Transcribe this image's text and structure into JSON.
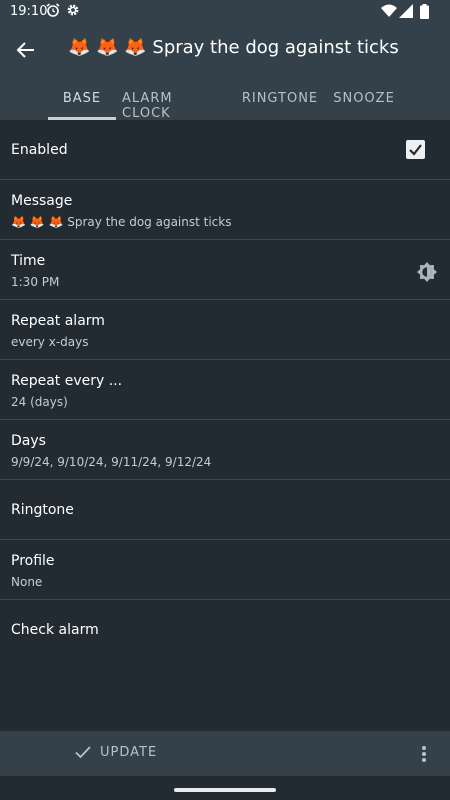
{
  "status_bar": {
    "time": "19:10",
    "icons": [
      "alarm-icon",
      "settings-icon",
      "wifi-icon",
      "signal-icon",
      "battery-icon"
    ]
  },
  "app_bar": {
    "back_icon": "arrow-back-icon",
    "title": "🦊 🦊 🦊 Spray the dog against ticks"
  },
  "tabs": [
    {
      "label": "BASE",
      "active": true
    },
    {
      "label": "ALARM CLOCK",
      "active": false
    },
    {
      "label": "RINGTONE",
      "active": false
    },
    {
      "label": "SNOOZE",
      "active": false
    }
  ],
  "settings": {
    "enabled": {
      "title": "Enabled",
      "checked": true
    },
    "message": {
      "title": "Message",
      "value": "🦊 🦊 🦊 Spray the dog against ticks"
    },
    "time": {
      "title": "Time",
      "value": "1:30 PM",
      "icon": "brightness-icon"
    },
    "repeat_alarm": {
      "title": "Repeat alarm",
      "value": "every x-days"
    },
    "repeat_every": {
      "title": "Repeat every ...",
      "value": "24 (days)"
    },
    "days": {
      "title": "Days",
      "value": "9/9/24, 9/10/24, 9/11/24, 9/12/24"
    },
    "ringtone": {
      "title": "Ringtone"
    },
    "profile": {
      "title": "Profile",
      "value": "None"
    },
    "check_alarm": {
      "title": "Check alarm"
    }
  },
  "bottom_bar": {
    "update_label": "UPDATE",
    "update_icon": "check-icon",
    "more_icon": "more-vert-icon"
  },
  "colors": {
    "background": "#232b32",
    "bar": "#34414b",
    "divider": "#3c464e",
    "secondary_text": "#c5ccd1"
  }
}
